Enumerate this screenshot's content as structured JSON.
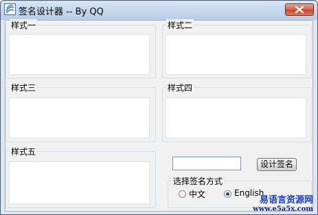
{
  "window": {
    "title": "签名设计器 -- By QQ"
  },
  "groups": [
    {
      "label": "样式一"
    },
    {
      "label": "样式二"
    },
    {
      "label": "样式三"
    },
    {
      "label": "样式四"
    },
    {
      "label": "样式五"
    }
  ],
  "controls": {
    "name_input_value": "",
    "design_button_label": "设计签名",
    "method_group_label": "选择签名方式",
    "radio_chinese_label": "中文",
    "radio_english_label": "English",
    "selected_method": "English"
  },
  "watermark": {
    "brand": "易语言资源网",
    "url": "www.e5a5x.com"
  }
}
